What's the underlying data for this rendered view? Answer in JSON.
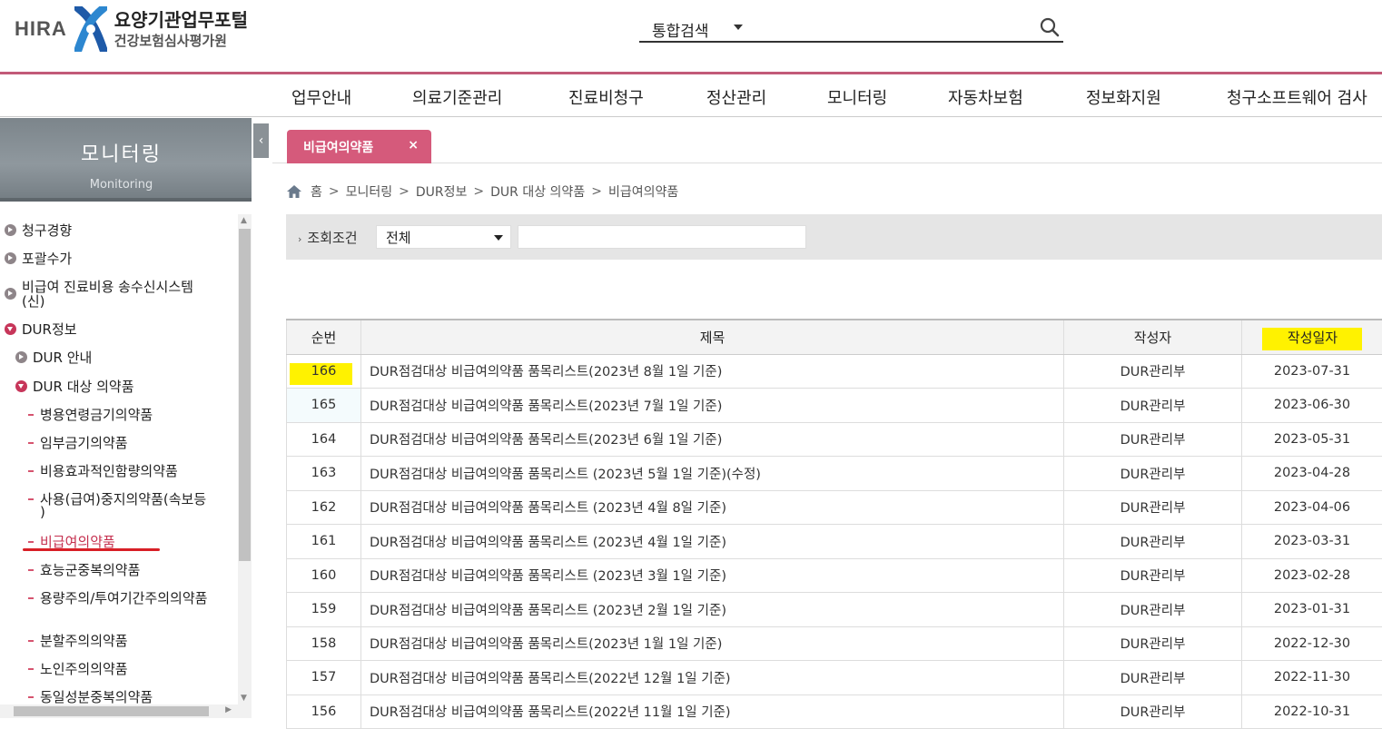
{
  "header": {
    "logo_short": "HIRA",
    "logo_title": "요양기관업무포털",
    "logo_subtitle": "건강보험심사평가원",
    "search_scope": "통합검색"
  },
  "gnb": [
    "업무안내",
    "의료기준관리",
    "진료비청구",
    "정산관리",
    "모니터링",
    "자동차보험",
    "정보화지원",
    "청구소프트웨어 검사"
  ],
  "sidebar": {
    "title": "모니터링",
    "subtitle": "Monitoring",
    "items": [
      {
        "label": "청구경향"
      },
      {
        "label": "포괄수가"
      },
      {
        "label": "비급여 진료비용 송수신시스템"
      },
      {
        "label": "(신)"
      },
      {
        "label": "DUR정보"
      },
      {
        "label": "DUR 안내"
      },
      {
        "label": "DUR 대상 의약품"
      },
      {
        "label": "병용연령금기의약품"
      },
      {
        "label": "임부금기의약품"
      },
      {
        "label": "비용효과적인함량의약품"
      },
      {
        "label": "사용(급여)중지의약품(속보등"
      },
      {
        "label": ")"
      },
      {
        "label": "비급여의약품"
      },
      {
        "label": "효능군중복의약품"
      },
      {
        "label": "용량주의/투여기간주의의약품"
      },
      {
        "label": "분할주의의약품"
      },
      {
        "label": "노인주의의약품"
      },
      {
        "label": "동일성분중복의약품"
      }
    ]
  },
  "tab": {
    "label": "비급여의약품",
    "close": "×"
  },
  "breadcrumb": [
    "홈",
    "모니터링",
    "DUR정보",
    "DUR 대상 의약품",
    "비급여의약품"
  ],
  "filter": {
    "label": "조회조건",
    "select_value": "전체",
    "text_value": ""
  },
  "table": {
    "headers": [
      "순번",
      "제목",
      "작성자",
      "작성일자"
    ],
    "rows": [
      {
        "no": "166",
        "title": "DUR점검대상 비급여의약품 품목리스트(2023년 8월 1일 기준)",
        "author": "DUR관리부",
        "date": "2023-07-31"
      },
      {
        "no": "165",
        "title": "DUR점검대상 비급여의약품 품목리스트(2023년 7월 1일 기준)",
        "author": "DUR관리부",
        "date": "2023-06-30"
      },
      {
        "no": "164",
        "title": "DUR점검대상 비급여의약품 품목리스트(2023년 6월 1일 기준)",
        "author": "DUR관리부",
        "date": "2023-05-31"
      },
      {
        "no": "163",
        "title": "DUR점검대상 비급여의약품 품목리스트 (2023년 5월 1일 기준)(수정)",
        "author": "DUR관리부",
        "date": "2023-04-28"
      },
      {
        "no": "162",
        "title": "DUR점검대상 비급여의약품 품목리스트 (2023년 4월 8일 기준)",
        "author": "DUR관리부",
        "date": "2023-04-06"
      },
      {
        "no": "161",
        "title": "DUR점검대상 비급여의약품 품목리스트 (2023년 4월 1일 기준)",
        "author": "DUR관리부",
        "date": "2023-03-31"
      },
      {
        "no": "160",
        "title": "DUR점검대상 비급여의약품 품목리스트 (2023년 3월 1일 기준)",
        "author": "DUR관리부",
        "date": "2023-02-28"
      },
      {
        "no": "159",
        "title": "DUR점검대상 비급여의약품 품목리스트 (2023년 2월 1일 기준)",
        "author": "DUR관리부",
        "date": "2023-01-31"
      },
      {
        "no": "158",
        "title": "DUR점검대상 비급여의약품 품목리스트(2023년 1월 1일 기준)",
        "author": "DUR관리부",
        "date": "2022-12-30"
      },
      {
        "no": "157",
        "title": "DUR점검대상 비급여의약품 품목리스트(2022년 12월 1일 기준)",
        "author": "DUR관리부",
        "date": "2022-11-30"
      },
      {
        "no": "156",
        "title": "DUR점검대상 비급여의약품 품목리스트(2022년 11월 1일 기준)",
        "author": "DUR관리부",
        "date": "2022-10-31"
      }
    ]
  },
  "colors": {
    "brand_pink": "#d55a7b",
    "header_rule": "#c25a78",
    "highlight": "#fff200",
    "active_menu": "#c5304f"
  }
}
